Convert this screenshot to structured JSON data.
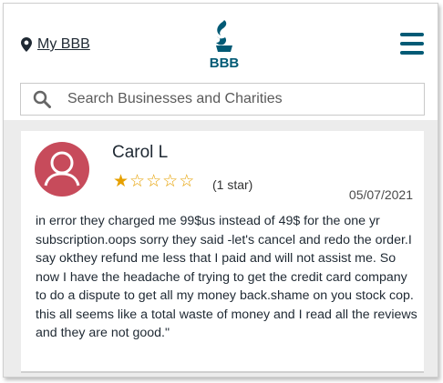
{
  "header": {
    "my_bbb_label": "My BBB",
    "logo_text": "BBB",
    "brand_color": "#015a75",
    "menu_icon": "hamburger-menu-icon"
  },
  "search": {
    "placeholder": "Search Businesses and Charities",
    "icon": "search-icon"
  },
  "review": {
    "reviewer_name": "Carol L",
    "rating": 1,
    "rating_max": 5,
    "rating_label": "(1 star)",
    "date": "05/07/2021",
    "text": "in error they charged me 99$us instead of 49$ for the one yr subscription.oops sorry they said -let's cancel and redo the order.I say okthey refund me less that I paid and will not assist me. So now I have the headache of trying to get the credit card company to do a dispute to get all my money back.shame on you stock cop. this all seems like a total waste of money and I read all the reviews and they are not good.\"",
    "avatar_color": "#c74b5b",
    "star_color": "#e6a000"
  }
}
